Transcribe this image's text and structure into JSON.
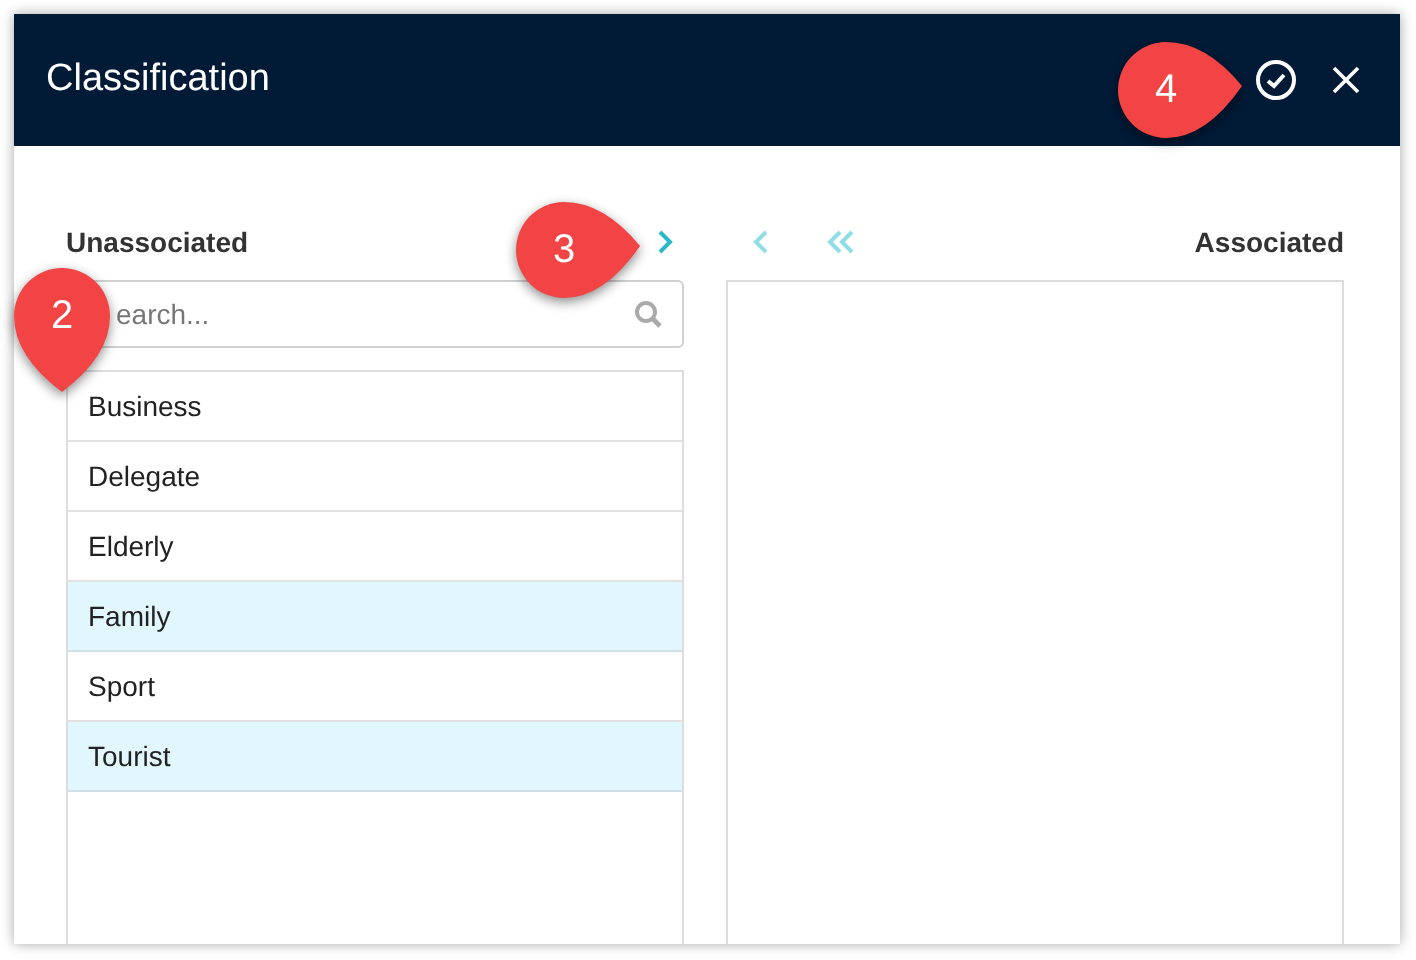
{
  "dialog": {
    "title": "Classification"
  },
  "unassociated": {
    "label": "Unassociated",
    "search": {
      "placeholder": "earch..."
    },
    "items": [
      {
        "label": "Business",
        "selected": false
      },
      {
        "label": "Delegate",
        "selected": false
      },
      {
        "label": "Elderly",
        "selected": false
      },
      {
        "label": "Family",
        "selected": true
      },
      {
        "label": "Sport",
        "selected": false
      },
      {
        "label": "Tourist",
        "selected": true
      }
    ]
  },
  "associated": {
    "label": "Associated"
  },
  "callouts": [
    {
      "number": "2",
      "kind": "down"
    },
    {
      "number": "3",
      "kind": "right"
    },
    {
      "number": "4",
      "kind": "right"
    }
  ]
}
